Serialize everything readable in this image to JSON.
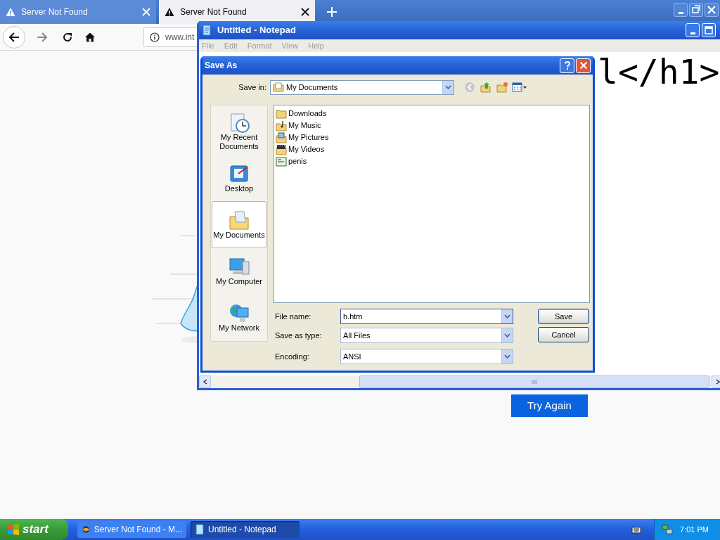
{
  "browser": {
    "tabs": [
      {
        "label": "Server Not Found",
        "selected": false
      },
      {
        "label": "Server Not Found",
        "selected": true
      }
    ],
    "url": "www.int",
    "button": "Try Again"
  },
  "notepad": {
    "title": "Untitled - Notepad",
    "menu": [
      {
        "label": "File",
        "disabled": true
      },
      {
        "label": "Edit",
        "disabled": true
      },
      {
        "label": "Format",
        "disabled": true
      },
      {
        "label": "View",
        "disabled": true
      },
      {
        "label": "Help",
        "disabled": true
      }
    ],
    "text": "l</h1>"
  },
  "save_dialog": {
    "title": "Save As",
    "save_in_label": "Save in:",
    "save_in": "My Documents",
    "places": [
      {
        "label": "My Recent Documents",
        "kind": "recent",
        "selected": false
      },
      {
        "label": "Desktop",
        "kind": "desktop",
        "selected": false
      },
      {
        "label": "My Documents",
        "kind": "documents",
        "selected": true
      },
      {
        "label": "My Computer",
        "kind": "computer",
        "selected": false
      },
      {
        "label": "My Network",
        "kind": "network",
        "selected": false
      }
    ],
    "files": [
      {
        "name": "Downloads",
        "kind": "folder"
      },
      {
        "name": "My Music",
        "kind": "music"
      },
      {
        "name": "My Pictures",
        "kind": "pictures"
      },
      {
        "name": "My Videos",
        "kind": "videos"
      },
      {
        "name": "penis",
        "kind": "text"
      }
    ],
    "fields": [
      {
        "label": "File name:",
        "value": "h.htm"
      },
      {
        "label": "Save as type:",
        "value": "All Files"
      },
      {
        "label": "Encoding:",
        "value": "ANSI"
      }
    ],
    "buttons": [
      "Save",
      "Cancel"
    ]
  },
  "taskbar": {
    "start": "start",
    "tasks": [
      {
        "label": "Server Not Found - M...",
        "selected": false
      },
      {
        "label": "Untitled - Notepad",
        "selected": true
      }
    ],
    "clock": "7:01 PM"
  }
}
